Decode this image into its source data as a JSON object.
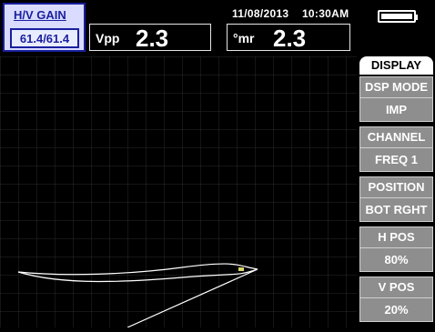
{
  "gain": {
    "title": "H/V GAIN",
    "value": "61.4/61.4"
  },
  "readouts": {
    "vpp": {
      "label": "Vpp",
      "value": "2.3"
    },
    "mr": {
      "label": "°mr",
      "value": "2.3"
    }
  },
  "status": {
    "date": "11/08/2013",
    "time": "10:30AM",
    "battery_level": 1.0
  },
  "menu": {
    "title": "DISPLAY",
    "items": [
      {
        "label": "DSP MODE",
        "value": "IMP"
      },
      {
        "label": "CHANNEL",
        "value": "FREQ 1"
      },
      {
        "label": "POSITION",
        "value": "BOT RGHT"
      },
      {
        "label": "H POS",
        "value": "80%"
      },
      {
        "label": "V POS",
        "value": "20%"
      }
    ]
  },
  "colors": {
    "background": "#000000",
    "menu_gray": "#8e8e8e",
    "gain_border": "#1a1f9e",
    "trace": "#ffffff",
    "grid": "#2a2a2a"
  }
}
